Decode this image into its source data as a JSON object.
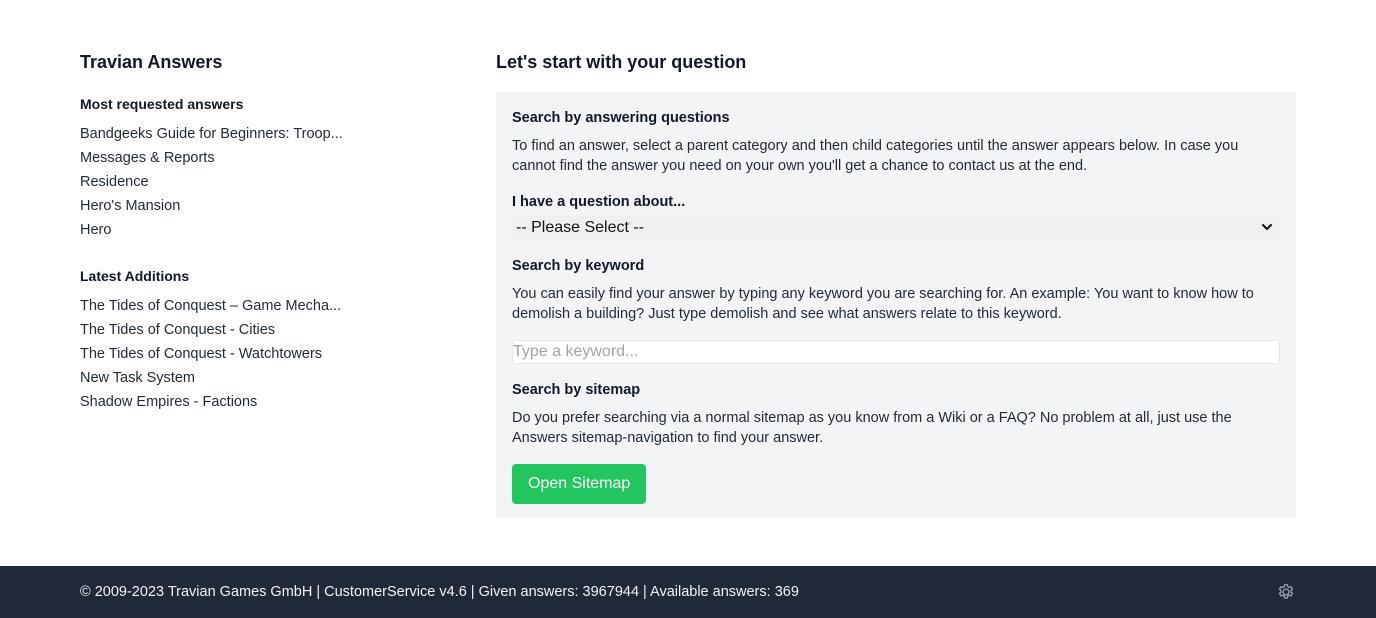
{
  "sidebar": {
    "title": "Travian Answers",
    "most_requested": {
      "heading": "Most requested answers",
      "items": [
        "Bandgeeks Guide for Beginners: Troop...",
        "Messages & Reports",
        "Residence",
        "Hero's Mansion",
        "Hero"
      ]
    },
    "latest": {
      "heading": "Latest Additions",
      "items": [
        "The Tides of Conquest – Game Mecha...",
        "The Tides of Conquest - Cities",
        "The Tides of Conquest - Watchtowers",
        "New Task System",
        "Shadow Empires - Factions"
      ]
    }
  },
  "main": {
    "title": "Let's start with your question",
    "search_questions": {
      "heading": "Search by answering questions",
      "description": "To find an answer, select a parent category and then child categories until the answer appears below. In case you cannot find the answer you need on your own you'll get a chance to contact us at the end.",
      "select_label": "I have a question about...",
      "select_value": "-- Please Select --"
    },
    "search_keyword": {
      "heading": "Search by keyword",
      "description": "You can easily find your answer by typing any keyword you are searching for. An example: You want to know how to demolish a building? Just type demolish and see what answers relate to this keyword.",
      "placeholder": "Type a keyword..."
    },
    "search_sitemap": {
      "heading": "Search by sitemap",
      "description": "Do you prefer searching via a normal sitemap as you know from a Wiki or a FAQ? No problem at all, just use the Answers sitemap-navigation to find your answer.",
      "button_label": "Open Sitemap"
    }
  },
  "footer": {
    "text": "© 2009-2023 Travian Games GmbH | CustomerService v4.6 | Given answers: 3967944 | Available answers: 369",
    "settings_icon": "gear-icon"
  },
  "colors": {
    "button": "#22c55e",
    "footer_bg": "#1f2937",
    "panel_bg": "#f3f4f6"
  }
}
